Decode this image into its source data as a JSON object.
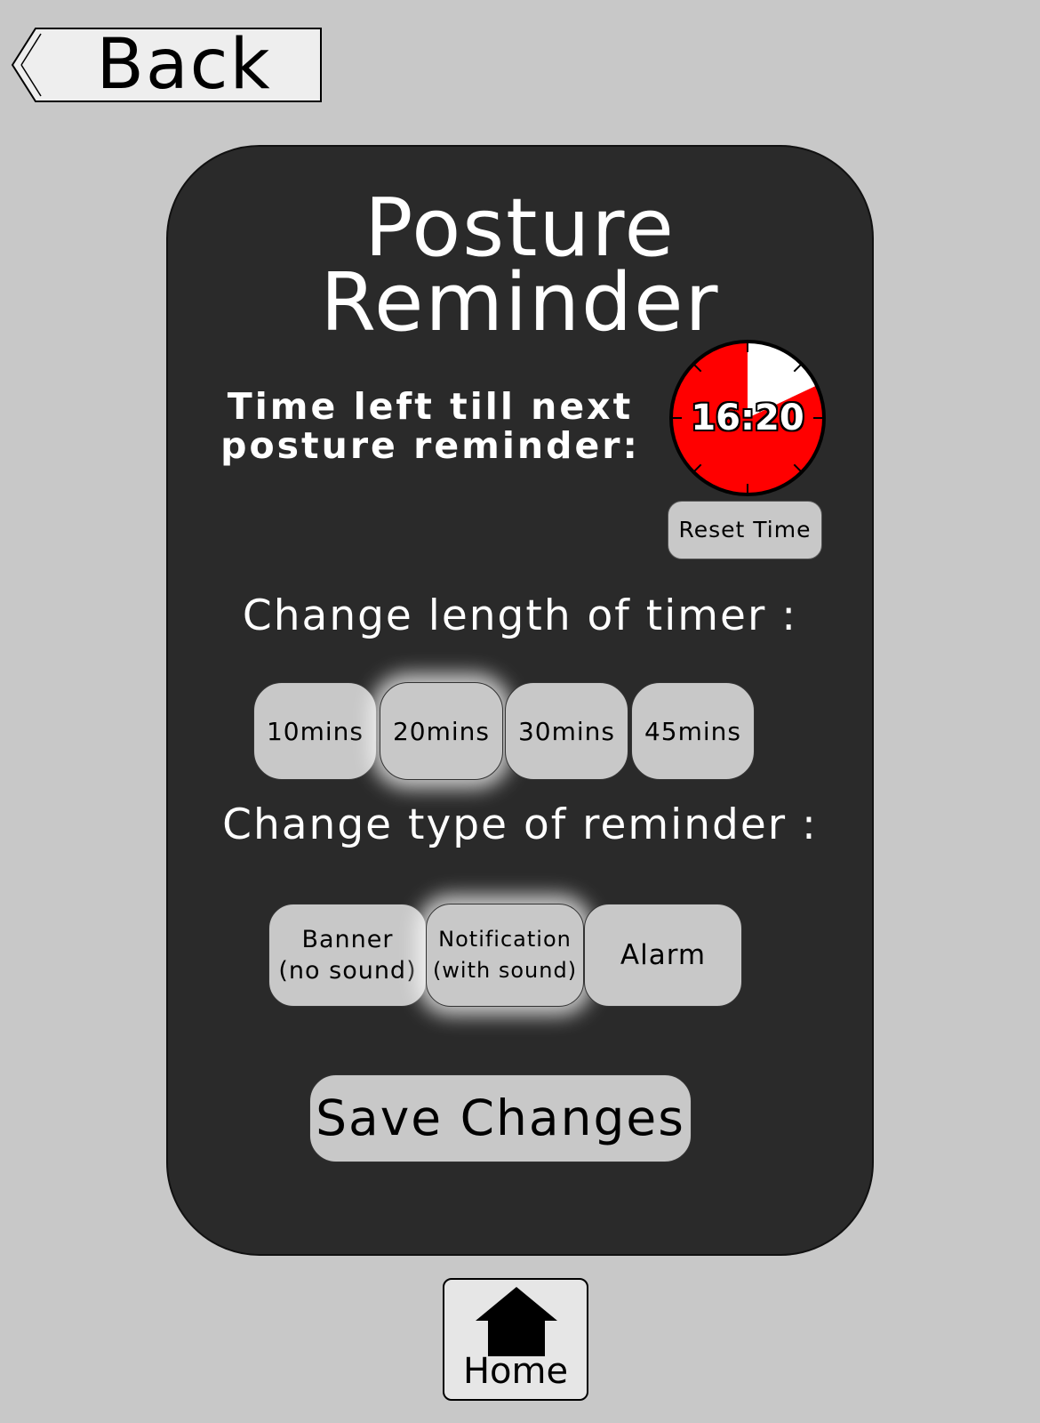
{
  "nav": {
    "back_label": "Back",
    "home_label": "Home"
  },
  "panel": {
    "title_line1": "Posture",
    "title_line2": "Reminder",
    "time_label_line1": "Time left till next",
    "time_label_line2": "posture reminder:",
    "timer": {
      "time_text": "16:20",
      "remaining_fraction": 0.82,
      "color": "#ff0000"
    },
    "reset_label": "Reset Time",
    "length_section_label": "Change length of timer :",
    "length_options": [
      "10mins",
      "20mins",
      "30mins",
      "45mins"
    ],
    "length_selected": "20mins",
    "type_section_label": "Change type of reminder :",
    "type_options": [
      {
        "line1": "Banner",
        "line2": "(no sound)"
      },
      {
        "line1": "Notification",
        "line2": "(with sound)"
      },
      {
        "line1": "Alarm",
        "line2": ""
      }
    ],
    "type_selected": "Notification",
    "save_label": "Save Changes"
  },
  "icons": {
    "back": "back-arrow-icon",
    "home": "house-icon"
  }
}
